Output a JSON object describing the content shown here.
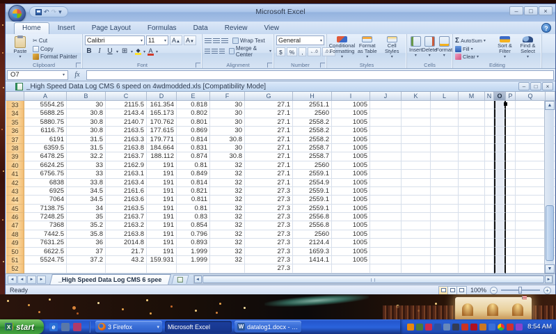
{
  "window": {
    "title": "Microsoft Excel"
  },
  "ribbon": {
    "tabs": [
      "Home",
      "Insert",
      "Page Layout",
      "Formulas",
      "Data",
      "Review",
      "View"
    ],
    "active_tab": "Home",
    "clipboard": {
      "label": "Clipboard",
      "paste": "Paste",
      "cut": "Cut",
      "copy": "Copy",
      "format_painter": "Format Painter"
    },
    "font": {
      "label": "Font",
      "name": "Calibri",
      "size": "11",
      "bold": "B",
      "italic": "I",
      "underline": "U"
    },
    "alignment": {
      "label": "Alignment",
      "wrap_text": "Wrap Text",
      "merge_center": "Merge & Center"
    },
    "number": {
      "label": "Number",
      "format": "General",
      "currency": "$",
      "percent": "%",
      "comma": ","
    },
    "styles": {
      "label": "Styles",
      "conditional": "Conditional Formatting",
      "format_table": "Format as Table",
      "cell_styles": "Cell Styles"
    },
    "cells": {
      "label": "Cells",
      "insert": "Insert",
      "delete": "Delete",
      "format": "Format"
    },
    "editing": {
      "label": "Editing",
      "sigma": "Σ",
      "autosum": "AutoSum",
      "fill": "Fill",
      "clear": "Clear",
      "sort_filter": "Sort & Filter",
      "find_select": "Find & Select"
    }
  },
  "formula_bar": {
    "name_box": "O7",
    "fx": "fx"
  },
  "document": {
    "title": "_High Speed Data Log CMS 6 speed on 4wdmodded.xls  [Compatibility Mode]"
  },
  "spreadsheet": {
    "columns": [
      "A",
      "B",
      "C",
      "D",
      "E",
      "F",
      "G",
      "H",
      "I",
      "J",
      "K",
      "L",
      "M",
      "N",
      "O",
      "P",
      "Q"
    ],
    "selected_column": "O",
    "active_cell": "O7",
    "rows": [
      {
        "num": "33",
        "cells": [
          "5554.25",
          "30",
          "2115.5",
          "161.354",
          "0.818",
          "30",
          "27.1",
          "2551.1",
          "1005"
        ]
      },
      {
        "num": "34",
        "cells": [
          "5688.25",
          "30.8",
          "2143.4",
          "165.173",
          "0.802",
          "30",
          "27.1",
          "2560",
          "1005"
        ]
      },
      {
        "num": "35",
        "cells": [
          "5880.75",
          "30.8",
          "2140.7",
          "170.762",
          "0.801",
          "30",
          "27.1",
          "2558.2",
          "1005"
        ]
      },
      {
        "num": "36",
        "cells": [
          "6116.75",
          "30.8",
          "2163.5",
          "177.615",
          "0.869",
          "30",
          "27.1",
          "2558.2",
          "1005"
        ]
      },
      {
        "num": "37",
        "cells": [
          "6191",
          "31.5",
          "2163.3",
          "179.771",
          "0.814",
          "30.8",
          "27.1",
          "2558.2",
          "1005"
        ]
      },
      {
        "num": "38",
        "cells": [
          "6359.5",
          "31.5",
          "2163.8",
          "184.664",
          "0.831",
          "30",
          "27.1",
          "2558.7",
          "1005"
        ]
      },
      {
        "num": "39",
        "cells": [
          "6478.25",
          "32.2",
          "2163.7",
          "188.112",
          "0.874",
          "30.8",
          "27.1",
          "2558.7",
          "1005"
        ]
      },
      {
        "num": "40",
        "cells": [
          "6624.25",
          "33",
          "2162.9",
          "191",
          "0.81",
          "32",
          "27.1",
          "2560",
          "1005"
        ]
      },
      {
        "num": "41",
        "cells": [
          "6756.75",
          "33",
          "2163.1",
          "191",
          "0.849",
          "32",
          "27.1",
          "2559.1",
          "1005"
        ]
      },
      {
        "num": "42",
        "cells": [
          "6838",
          "33.8",
          "2163.4",
          "191",
          "0.814",
          "32",
          "27.1",
          "2554.9",
          "1005"
        ]
      },
      {
        "num": "43",
        "cells": [
          "6925",
          "34.5",
          "2161.6",
          "191",
          "0.821",
          "32",
          "27.3",
          "2559.1",
          "1005"
        ]
      },
      {
        "num": "44",
        "cells": [
          "7064",
          "34.5",
          "2163.6",
          "191",
          "0.811",
          "32",
          "27.3",
          "2559.1",
          "1005"
        ]
      },
      {
        "num": "45",
        "cells": [
          "7138.75",
          "34",
          "2163.5",
          "191",
          "0.81",
          "32",
          "27.3",
          "2559.1",
          "1005"
        ]
      },
      {
        "num": "46",
        "cells": [
          "7248.25",
          "35",
          "2163.7",
          "191",
          "0.83",
          "32",
          "27.3",
          "2556.8",
          "1005"
        ]
      },
      {
        "num": "47",
        "cells": [
          "7368",
          "35.2",
          "2163.2",
          "191",
          "0.854",
          "32",
          "27.3",
          "2556.8",
          "1005"
        ]
      },
      {
        "num": "48",
        "cells": [
          "7442.5",
          "35.8",
          "2163.8",
          "191",
          "0.796",
          "32",
          "27.3",
          "2560",
          "1005"
        ]
      },
      {
        "num": "49",
        "cells": [
          "7631.25",
          "36",
          "2014.8",
          "191",
          "0.893",
          "32",
          "27.3",
          "2124.4",
          "1005"
        ]
      },
      {
        "num": "50",
        "cells": [
          "6622.5",
          "37",
          "21.7",
          "191",
          "1.999",
          "32",
          "27.3",
          "1659.3",
          "1005"
        ]
      },
      {
        "num": "51",
        "cells": [
          "5524.75",
          "37.2",
          "43.2",
          "159.931",
          "1.999",
          "32",
          "27.3",
          "1414.1",
          "1005"
        ]
      },
      {
        "num": "52",
        "cells": [
          "",
          "",
          "",
          "",
          "",
          "",
          "27.3",
          "",
          ""
        ]
      }
    ]
  },
  "sheet_bar": {
    "tab": "_High Speed Data Log CMS 6 spee"
  },
  "status_bar": {
    "mode": "Ready",
    "zoom": "100%"
  },
  "taskbar": {
    "start": "start",
    "tasks": [
      {
        "label": "3 Firefox",
        "icon": "firefox",
        "grouped": true,
        "active": false
      },
      {
        "label": "Microsoft Excel",
        "icon": "excel",
        "grouped": false,
        "active": true
      },
      {
        "label": "datalog1.docx - Micro...",
        "icon": "word",
        "grouped": false,
        "active": false
      }
    ],
    "quick_launch": [
      {
        "name": "internet-explorer-icon",
        "glyph": "e",
        "color": "#2a6fd6"
      },
      {
        "name": "show-desktop-icon",
        "glyph": "",
        "color": "#5a78a8"
      },
      {
        "name": "messenger-icon",
        "glyph": "",
        "color": "#b03a6a"
      }
    ],
    "tray_colors": [
      "#e8890c",
      "#4a7a3a",
      "#cc2b4e",
      "#2b4fa0",
      "#6688bb",
      "#333c55",
      "#cc3322",
      "#b01020",
      "#cc7722",
      "#3a6fd8",
      "pinwheel",
      "#d03030",
      "#8844cc"
    ],
    "clock": "8:54 AM"
  },
  "icons": {
    "help": "?",
    "min": "–",
    "restore": "□",
    "close": "×",
    "dropdown": "▾",
    "undo": "↶",
    "redo": "↷",
    "qat_more": "▾",
    "nav_first": "◄",
    "nav_prev": "◄",
    "nav_next": "►",
    "nav_last": "►",
    "scroll_up": "▲",
    "scroll_down": "▼",
    "scroll_left": "◄",
    "scroll_right": "►",
    "cut": "✂",
    "grow_font": "A",
    "shrink_font": "A",
    "font_color": "A",
    "border": "⊞",
    "task_group_arrow": "▾"
  }
}
